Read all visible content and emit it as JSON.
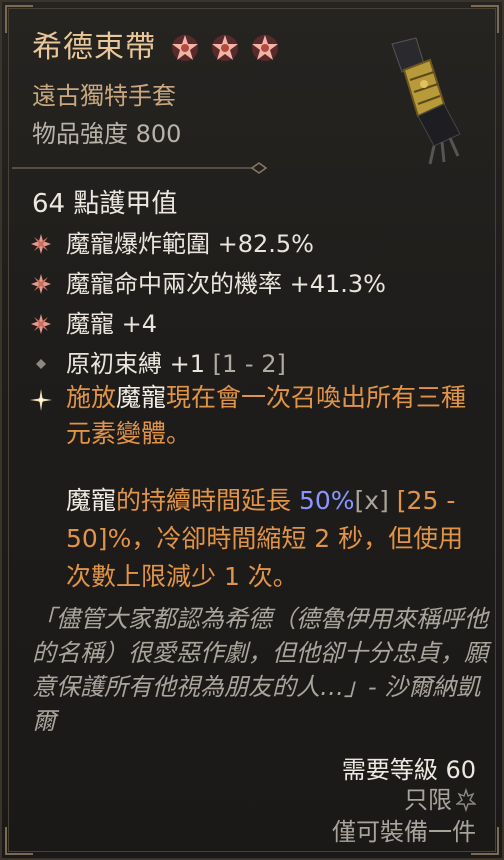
{
  "item": {
    "name": "希德束帶",
    "type": "遠古獨特手套",
    "power": "物品強度 800",
    "stars": 3
  },
  "armor": "64 點護甲值",
  "affixes": [
    {
      "text": "魔寵爆炸範圍 +82.5%",
      "icon": "ornate-bullet-icon"
    },
    {
      "text": "魔寵命中兩次的機率 +41.3%",
      "icon": "ornate-bullet-icon"
    },
    {
      "text": "魔寵 +4",
      "icon": "ornate-bullet-icon"
    },
    {
      "text": "原初束縛 +1",
      "range": " [1 - 2]",
      "icon": "diamond-bullet-icon"
    }
  ],
  "unique_power": {
    "p1": "施放",
    "p2": "魔寵",
    "p3": "現在會一次召喚出所有三種元素變體。"
  },
  "effect": {
    "e1": "魔寵",
    "e2": "的持續時間延長 ",
    "e3": "50%",
    "e4": "[x]",
    "e5": " [25 - 50]%，冷卻時間縮短 2 秒，但使用次數上限減少 1 次。"
  },
  "flavor": "「儘管大家都認為希德（德魯伊用來稱呼他的名稱）很愛惡作劇，但他卻十分忠貞，願意保護所有他視為朋友的人…」- 沙爾納凱爾",
  "requirements": {
    "level": "需要等級 60",
    "limit": "只限",
    "equip": "僅可裝備一件"
  },
  "colors": {
    "title": "#e8c79a",
    "unique": "#e09448",
    "highlight": "#8a96ff",
    "star": "#e8a49a"
  }
}
